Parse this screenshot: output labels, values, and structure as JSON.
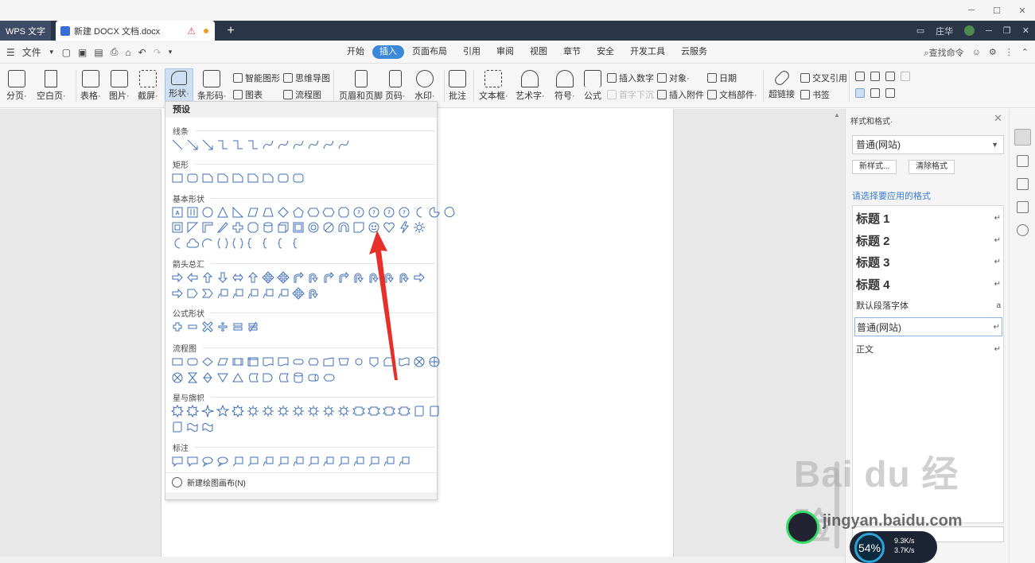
{
  "app": {
    "name": "WPS 文字",
    "doc_title": "新建 DOCX 文档.docx",
    "user": "庄华"
  },
  "menu": {
    "file_label": "文件",
    "tabs": [
      {
        "label": "开始"
      },
      {
        "label": "插入"
      },
      {
        "label": "页面布局"
      },
      {
        "label": "引用"
      },
      {
        "label": "审阅"
      },
      {
        "label": "视图"
      },
      {
        "label": "章节"
      },
      {
        "label": "安全"
      },
      {
        "label": "开发工具"
      },
      {
        "label": "云服务"
      }
    ],
    "search_label": "查找命令"
  },
  "ribbon": {
    "page_break": "分页·",
    "blank_page": "空白页·",
    "table": "表格·",
    "picture": "图片·",
    "screenshot": "截屏·",
    "shape": "形状·",
    "barcode": "条形码·",
    "smart_art": "智能图形",
    "mind_map": "思维导图",
    "chart": "图表",
    "flowchart": "流程图",
    "header_footer": "页眉和页脚",
    "page_number": "页码·",
    "watermark": "水印·",
    "comment": "批注",
    "text_box": "文本框·",
    "art_text": "艺术字·",
    "symbol": "符号·",
    "formula": "公式",
    "insert_number": "插入数字",
    "drop_cap": "首字下沉",
    "object": "对象·",
    "attachment": "插入附件",
    "date": "日期",
    "doc_parts": "文档部件·",
    "hyperlink": "超链接",
    "cross_ref": "交叉引用",
    "bookmark": "书签"
  },
  "shapes_panel": {
    "header": "预设",
    "categories": [
      {
        "label": "线条"
      },
      {
        "label": "矩形"
      },
      {
        "label": "基本形状"
      },
      {
        "label": "箭头总汇"
      },
      {
        "label": "公式形状"
      },
      {
        "label": "流程图"
      },
      {
        "label": "星与旗帜"
      },
      {
        "label": "标注"
      }
    ],
    "footer": "新建绘图画布(N)"
  },
  "styles_panel": {
    "title": "样式和格式·",
    "current_style": "普通(网站)",
    "new_style_btn": "新样式...",
    "clear_format_btn": "清除格式",
    "choose_label": "请选择要应用的格式",
    "items": [
      {
        "label": "标题  1",
        "mark": "↵"
      },
      {
        "label": "标题  2",
        "mark": "↵"
      },
      {
        "label": "标题  3",
        "mark": "↵"
      },
      {
        "label": "标题  4",
        "mark": "↵"
      },
      {
        "label": "默认段落字体",
        "mark": "a"
      },
      {
        "label": "普通(网站)",
        "mark": "↵"
      },
      {
        "label": "正文",
        "mark": "↵"
      }
    ]
  },
  "overlay": {
    "watermark_text": "Bai du 经验",
    "watermark_url": "jingyan.baidu.com",
    "badge_pct": "54%",
    "up_speed": "9.3K/s",
    "down_speed": "3.7K/s"
  },
  "colors": {
    "accent": "#3c88d8",
    "arrow": "#e8302a",
    "tabbar": "#2b3548"
  }
}
